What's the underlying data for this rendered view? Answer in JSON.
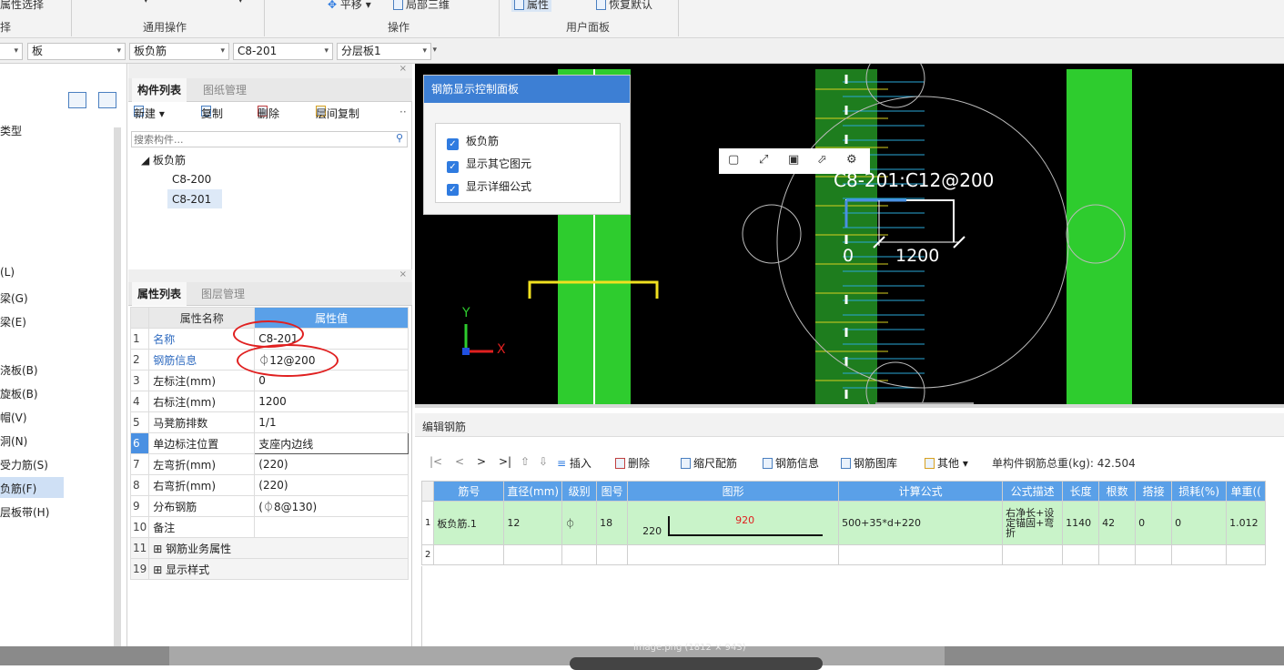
{
  "ribbon": {
    "items": [
      {
        "label": "属性选择"
      },
      {
        "label": "▾"
      },
      {
        "label": "▾"
      },
      {
        "label": "平移 ▾"
      },
      {
        "label": "局部三维"
      },
      {
        "label": "属性"
      },
      {
        "label": "恢复默认"
      }
    ],
    "groups": [
      "择",
      "通用操作",
      "操作",
      "用户面板"
    ]
  },
  "filter": {
    "combos": [
      "",
      "板",
      "板负筋",
      "C8-201",
      "分层板1",
      ""
    ]
  },
  "nav": {
    "items": [
      "类型",
      "(L)",
      "梁(G)",
      "梁(E)",
      "浇板(B)",
      "旋板(B)",
      "帽(V)",
      "洞(N)",
      "受力筋(S)",
      "负筋(F)",
      "层板带(H)"
    ]
  },
  "component_panel": {
    "tabs": [
      "构件列表",
      "图纸管理"
    ],
    "toolbar": [
      "新建 ▾",
      "复制",
      "删除",
      "层间复制",
      "··"
    ],
    "search_placeholder": "搜索构件...",
    "tree": {
      "root": "◢ 板负筋",
      "children": [
        "C8-200",
        "C8-201"
      ]
    }
  },
  "property_panel": {
    "tabs": [
      "属性列表",
      "图层管理"
    ],
    "headers": [
      "属性名称",
      "属性值"
    ],
    "rows": [
      {
        "num": "1",
        "name": "名称",
        "value": "C8-201"
      },
      {
        "num": "2",
        "name": "钢筋信息",
        "value": "⏀12@200"
      },
      {
        "num": "3",
        "name": "左标注(mm)",
        "value": "0"
      },
      {
        "num": "4",
        "name": "右标注(mm)",
        "value": "1200"
      },
      {
        "num": "5",
        "name": "马凳筋排数",
        "value": "1/1"
      },
      {
        "num": "6",
        "name": "单边标注位置",
        "value": "支座内边线"
      },
      {
        "num": "7",
        "name": "左弯折(mm)",
        "value": "(220)"
      },
      {
        "num": "8",
        "name": "右弯折(mm)",
        "value": "(220)"
      },
      {
        "num": "9",
        "name": "分布钢筋",
        "value": "(⏀8@130)"
      },
      {
        "num": "10",
        "name": "备注",
        "value": ""
      },
      {
        "num": "11",
        "name": "⊞ 钢筋业务属性",
        "value": ""
      },
      {
        "num": "19",
        "name": "⊞ 显示样式",
        "value": ""
      }
    ]
  },
  "control_panel": {
    "title": "钢筋显示控制面板",
    "options": [
      "板负筋",
      "显示其它图元",
      "显示详细公式"
    ]
  },
  "canvas": {
    "label": "C8-201:C12@200",
    "dim_left": "0",
    "dim_value": "1200",
    "axis_y": "Y",
    "axis_x": "X"
  },
  "edit": {
    "title": "编辑钢筋",
    "toolbar": [
      "|<",
      "<",
      ">",
      ">|",
      "插入",
      "删除",
      "缩尺配筋",
      "钢筋信息",
      "钢筋图库",
      "其他 ▾"
    ],
    "total": "单构件钢筋总重(kg): 42.504",
    "headers": [
      "筋号",
      "直径(mm)",
      "级别",
      "图号",
      "图形",
      "计算公式",
      "公式描述",
      "长度",
      "根数",
      "搭接",
      "损耗(%)",
      "单重(("
    ],
    "rows": [
      {
        "num": "1",
        "name": "板负筋.1",
        "dia": "12",
        "grade": "⏀",
        "fig": "18",
        "shape_left": "220",
        "shape_main": "920",
        "formula": "500+35*d+220",
        "desc": "右净长+设定锚固+弯折",
        "length": "1140",
        "count": "42",
        "lap": "0",
        "loss": "0",
        "unit": "1.012"
      },
      {
        "num": "2"
      }
    ]
  },
  "footer": {
    "caption": "image.png (1812 × 943)"
  }
}
